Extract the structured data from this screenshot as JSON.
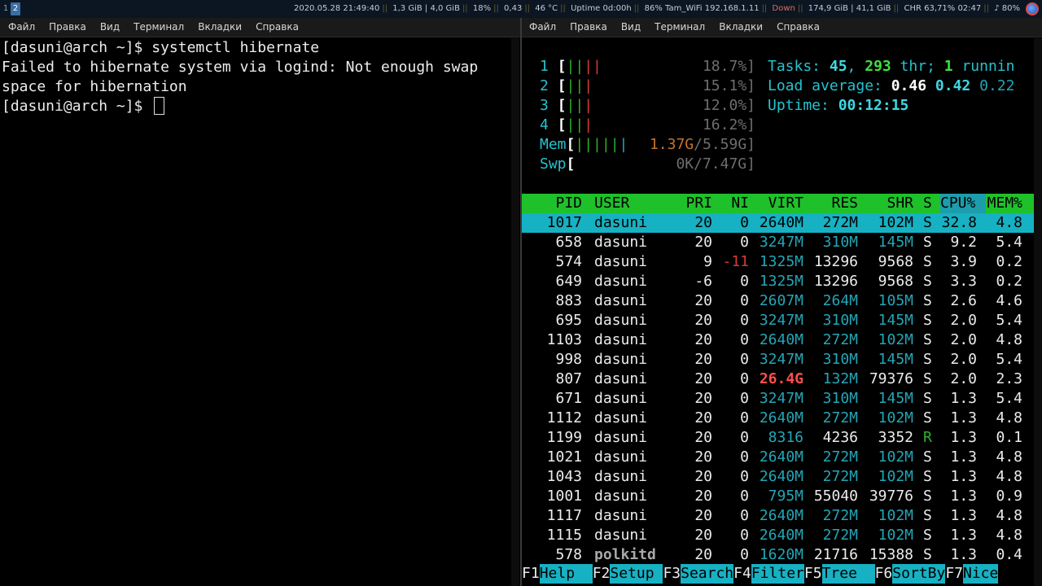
{
  "topbar": {
    "workspaces": [
      "1",
      "2"
    ],
    "status": [
      "2020.05.28 21:49:40",
      "1,3 GiB | 4,0 GiB",
      "18%",
      "0,43",
      "46 °C",
      "Uptime 0d:00h",
      "86% Tam_WiFi 192.168.1.11",
      "Down",
      "174,9 GiB | 41,1 GiB",
      "CHR 63,71%",
      "02:47",
      "♪ 80%"
    ]
  },
  "menu": [
    "Файл",
    "Правка",
    "Вид",
    "Терминал",
    "Вкладки",
    "Справка"
  ],
  "left_terminal": {
    "lines": [
      "[dasuni@arch ~]$ systemctl hibernate",
      "Failed to hibernate system via logind: Not enough swap",
      "space for hibernation"
    ],
    "prompt": "[dasuni@arch ~]$ "
  },
  "htop": {
    "cpus": [
      {
        "id": "1",
        "bars_green": "||",
        "bars_red": "||",
        "pct": "18.7%]"
      },
      {
        "id": "2",
        "bars_green": "||",
        "bars_red": "|",
        "pct": "15.1%]"
      },
      {
        "id": "3",
        "bars_green": "||",
        "bars_red": "|",
        "pct": "12.0%]"
      },
      {
        "id": "4",
        "bars_green": "||",
        "bars_red": "|",
        "pct": "16.2%]"
      }
    ],
    "mem": {
      "label": "Mem",
      "bars": "|||||",
      "value": "1.37G/5.59G]"
    },
    "swp": {
      "label": "Swp",
      "value": "0K/7.47G]"
    },
    "tasks": {
      "label": "Tasks: ",
      "count": "45",
      "sep1": ", ",
      "thr": "293",
      "thr_label": " thr; ",
      "running": "1",
      "running_label": " runnin"
    },
    "load": {
      "label": "Load average: ",
      "l1": "0.46",
      "l5": "0.42",
      "l15": "0.22"
    },
    "uptime": {
      "label": "Uptime: ",
      "value": "00:12:15"
    },
    "columns": [
      "PID",
      "USER",
      "PRI",
      "NI",
      "VIRT",
      "RES",
      "SHR",
      "S",
      "CPU%",
      "MEM%"
    ],
    "processes": [
      {
        "pid": "1017",
        "user": "dasuni",
        "pri": "20",
        "ni": "0",
        "virt": "2640M",
        "res": "272M",
        "shr": "102M",
        "s": "S",
        "cpu": "32.8",
        "mem": "4.8"
      },
      {
        "pid": "658",
        "user": "dasuni",
        "pri": "20",
        "ni": "0",
        "virt": "3247M",
        "res": "310M",
        "shr": "145M",
        "s": "S",
        "cpu": "9.2",
        "mem": "5.4"
      },
      {
        "pid": "574",
        "user": "dasuni",
        "pri": "9",
        "ni": "-11",
        "virt": "1325M",
        "res": "13296",
        "shr": "9568",
        "s": "S",
        "cpu": "3.9",
        "mem": "0.2"
      },
      {
        "pid": "649",
        "user": "dasuni",
        "pri": "-6",
        "ni": "0",
        "virt": "1325M",
        "res": "13296",
        "shr": "9568",
        "s": "S",
        "cpu": "3.3",
        "mem": "0.2"
      },
      {
        "pid": "883",
        "user": "dasuni",
        "pri": "20",
        "ni": "0",
        "virt": "2607M",
        "res": "264M",
        "shr": "105M",
        "s": "S",
        "cpu": "2.6",
        "mem": "4.6"
      },
      {
        "pid": "695",
        "user": "dasuni",
        "pri": "20",
        "ni": "0",
        "virt": "3247M",
        "res": "310M",
        "shr": "145M",
        "s": "S",
        "cpu": "2.0",
        "mem": "5.4"
      },
      {
        "pid": "1103",
        "user": "dasuni",
        "pri": "20",
        "ni": "0",
        "virt": "2640M",
        "res": "272M",
        "shr": "102M",
        "s": "S",
        "cpu": "2.0",
        "mem": "4.8"
      },
      {
        "pid": "998",
        "user": "dasuni",
        "pri": "20",
        "ni": "0",
        "virt": "3247M",
        "res": "310M",
        "shr": "145M",
        "s": "S",
        "cpu": "2.0",
        "mem": "5.4"
      },
      {
        "pid": "807",
        "user": "dasuni",
        "pri": "20",
        "ni": "0",
        "virt": "26.4G",
        "res": "132M",
        "shr": "79376",
        "s": "S",
        "cpu": "2.0",
        "mem": "2.3"
      },
      {
        "pid": "671",
        "user": "dasuni",
        "pri": "20",
        "ni": "0",
        "virt": "3247M",
        "res": "310M",
        "shr": "145M",
        "s": "S",
        "cpu": "1.3",
        "mem": "5.4"
      },
      {
        "pid": "1112",
        "user": "dasuni",
        "pri": "20",
        "ni": "0",
        "virt": "2640M",
        "res": "272M",
        "shr": "102M",
        "s": "S",
        "cpu": "1.3",
        "mem": "4.8"
      },
      {
        "pid": "1199",
        "user": "dasuni",
        "pri": "20",
        "ni": "0",
        "virt": "8316",
        "res": "4236",
        "shr": "3352",
        "s": "R",
        "cpu": "1.3",
        "mem": "0.1"
      },
      {
        "pid": "1021",
        "user": "dasuni",
        "pri": "20",
        "ni": "0",
        "virt": "2640M",
        "res": "272M",
        "shr": "102M",
        "s": "S",
        "cpu": "1.3",
        "mem": "4.8"
      },
      {
        "pid": "1043",
        "user": "dasuni",
        "pri": "20",
        "ni": "0",
        "virt": "2640M",
        "res": "272M",
        "shr": "102M",
        "s": "S",
        "cpu": "1.3",
        "mem": "4.8"
      },
      {
        "pid": "1001",
        "user": "dasuni",
        "pri": "20",
        "ni": "0",
        "virt": "795M",
        "res": "55040",
        "shr": "39776",
        "s": "S",
        "cpu": "1.3",
        "mem": "0.9"
      },
      {
        "pid": "1117",
        "user": "dasuni",
        "pri": "20",
        "ni": "0",
        "virt": "2640M",
        "res": "272M",
        "shr": "102M",
        "s": "S",
        "cpu": "1.3",
        "mem": "4.8"
      },
      {
        "pid": "1115",
        "user": "dasuni",
        "pri": "20",
        "ni": "0",
        "virt": "2640M",
        "res": "272M",
        "shr": "102M",
        "s": "S",
        "cpu": "1.3",
        "mem": "4.8"
      },
      {
        "pid": "578",
        "user": "polkitd",
        "pri": "20",
        "ni": "0",
        "virt": "1620M",
        "res": "21716",
        "shr": "15388",
        "s": "S",
        "cpu": "1.3",
        "mem": "0.4"
      }
    ],
    "fkeys": [
      {
        "key": "F1",
        "label": "Help  "
      },
      {
        "key": "F2",
        "label": "Setup "
      },
      {
        "key": "F3",
        "label": "Search"
      },
      {
        "key": "F4",
        "label": "Filter"
      },
      {
        "key": "F5",
        "label": "Tree  "
      },
      {
        "key": "F6",
        "label": "SortBy"
      },
      {
        "key": "F7",
        "label": "Nice"
      }
    ]
  }
}
